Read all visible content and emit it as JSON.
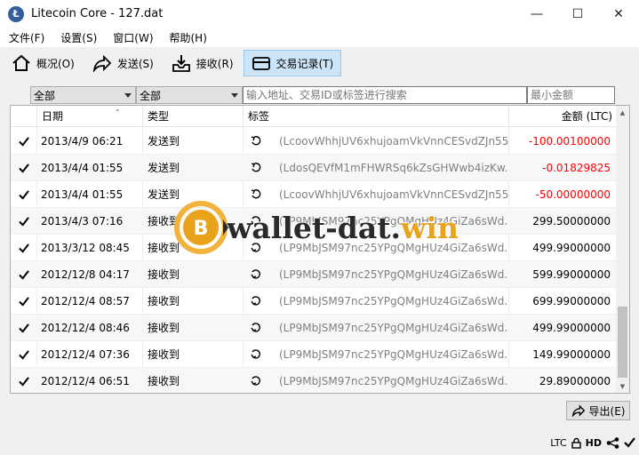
{
  "window": {
    "title": "Litecoin Core - 127.dat",
    "app_icon_letter": "Ł",
    "minimize": "—",
    "maximize": "☐",
    "close": "✕"
  },
  "menu": [
    "文件(F)",
    "设置(S)",
    "窗口(W)",
    "帮助(H)"
  ],
  "toolbar": {
    "overview": "概况(O)",
    "send": "发送(S)",
    "receive": "接收(R)",
    "transactions": "交易记录(T)"
  },
  "filters": {
    "date_filter": "全部",
    "type_filter": "全部",
    "search_placeholder": "输入地址、交易ID或标签进行搜索",
    "min_amount_placeholder": "最小金额"
  },
  "table": {
    "headers": {
      "date": "日期",
      "type": "类型",
      "label": "标签",
      "amount": "金额 (LTC)"
    },
    "rows": [
      {
        "date": "2013/4/9 06:21",
        "type": "发送到",
        "label": "(LcoovWhhjUV6xhujoamVkVnnCESvdZJn55)",
        "amount": "-100.00100000",
        "negative": true
      },
      {
        "date": "2013/4/4 01:55",
        "type": "发送到",
        "label": "(LdosQEVfM1mFHWRSq6kZsGHWwb4izKw...",
        "amount": "-0.01829825",
        "negative": true
      },
      {
        "date": "2013/4/4 01:55",
        "type": "发送到",
        "label": "(LcoovWhhjUV6xhujoamVkVnnCESvdZJn55)",
        "amount": "-50.00000000",
        "negative": true
      },
      {
        "date": "2013/4/3 07:16",
        "type": "接收到",
        "label": "(LP9MbJSM97nc25YPgQMgHUz4GiZa6sWd...",
        "amount": "299.50000000",
        "negative": false
      },
      {
        "date": "2013/3/12 08:45",
        "type": "接收到",
        "label": "(LP9MbJSM97nc25YPgQMgHUz4GiZa6sWd...",
        "amount": "499.99000000",
        "negative": false
      },
      {
        "date": "2012/12/8 04:17",
        "type": "接收到",
        "label": "(LP9MbJSM97nc25YPgQMgHUz4GiZa6sWd...",
        "amount": "599.99000000",
        "negative": false
      },
      {
        "date": "2012/12/4 08:57",
        "type": "接收到",
        "label": "(LP9MbJSM97nc25YPgQMgHUz4GiZa6sWd...",
        "amount": "699.99000000",
        "negative": false
      },
      {
        "date": "2012/12/4 08:46",
        "type": "接收到",
        "label": "(LP9MbJSM97nc25YPgQMgHUz4GiZa6sWd...",
        "amount": "499.99000000",
        "negative": false
      },
      {
        "date": "2012/12/4 07:36",
        "type": "接收到",
        "label": "(LP9MbJSM97nc25YPgQMgHUz4GiZa6sWd...",
        "amount": "149.99000000",
        "negative": false
      },
      {
        "date": "2012/12/4 06:51",
        "type": "接收到",
        "label": "(LP9MbJSM97nc25YPgQMgHUz4GiZa6sWd...",
        "amount": "29.89000000",
        "negative": false
      }
    ]
  },
  "watermark": {
    "text_part1": "wallet-dat.",
    "text_part2": "win",
    "coin_letter": "B"
  },
  "export_label": "导出(E)",
  "status": {
    "unit": "LTC",
    "hd": "HD"
  },
  "colors": {
    "negative": "#ff0000",
    "active_tab": "#cce4f7",
    "accent": "#e9a31a"
  }
}
